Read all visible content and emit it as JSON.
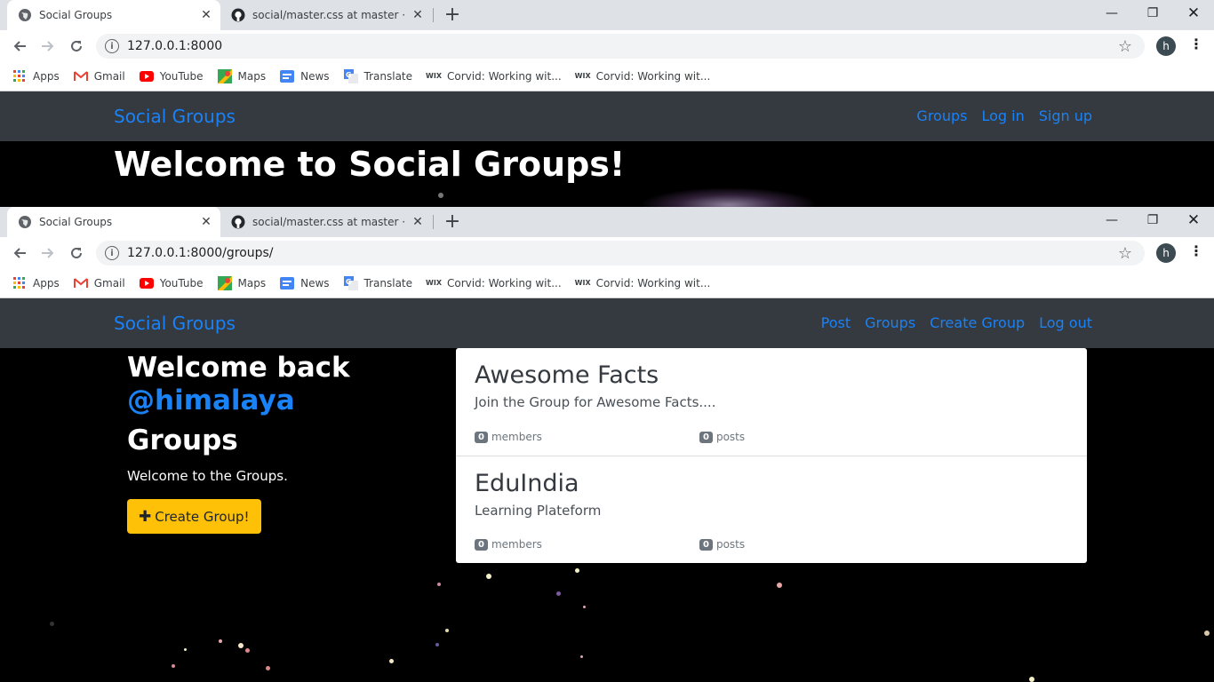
{
  "browser_top": {
    "tabs": [
      {
        "title": "Social Groups",
        "active": true
      },
      {
        "title": "social/master.css at master · Him",
        "active": false
      }
    ],
    "url": "127.0.0.1:8000",
    "avatar": "h"
  },
  "browser_bottom": {
    "tabs": [
      {
        "title": "Social Groups",
        "active": true
      },
      {
        "title": "social/master.css at master · Him",
        "active": false
      }
    ],
    "url": "127.0.0.1:8000/groups/",
    "avatar": "h"
  },
  "bookmarks": [
    {
      "label": "Apps",
      "icon": "apps-grid-icon"
    },
    {
      "label": "Gmail",
      "icon": "gmail-icon"
    },
    {
      "label": "YouTube",
      "icon": "youtube-icon"
    },
    {
      "label": "Maps",
      "icon": "maps-icon"
    },
    {
      "label": "News",
      "icon": "news-icon"
    },
    {
      "label": "Translate",
      "icon": "translate-icon"
    },
    {
      "label": "Corvid: Working wit...",
      "icon": "wix-icon"
    },
    {
      "label": "Corvid: Working wit...",
      "icon": "wix-icon"
    }
  ],
  "site_top": {
    "brand": "Social Groups",
    "nav": [
      "Groups",
      "Log in",
      "Sign up"
    ],
    "hero_title": "Welcome to Social Groups!"
  },
  "site_bottom": {
    "brand": "Social Groups",
    "nav": [
      "Post",
      "Groups",
      "Create Group",
      "Log out"
    ],
    "welcome_back": "Welcome back",
    "username": "@himalaya",
    "groups_heading": "Groups",
    "groups_intro": "Welcome to the Groups.",
    "create_button": "Create Group!"
  },
  "groups": [
    {
      "name": "Awesome Facts",
      "description": "Join the Group for Awesome Facts....",
      "members": "0",
      "members_label": "members",
      "posts": "0",
      "posts_label": "posts"
    },
    {
      "name": "EduIndia",
      "description": "Learning Plateform",
      "members": "0",
      "members_label": "members",
      "posts": "0",
      "posts_label": "posts"
    }
  ],
  "colors": {
    "navbar_bg": "#343a40",
    "link_blue": "#1a82f7",
    "button_yellow": "#ffc107",
    "page_bg": "#000000"
  }
}
